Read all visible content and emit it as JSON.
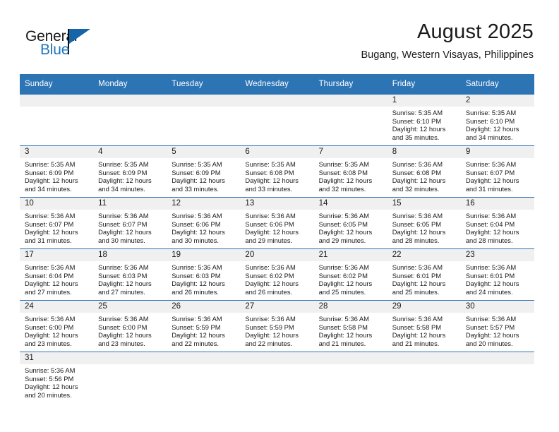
{
  "brand": {
    "name_part1": "General",
    "name_part2": "Blue",
    "flag_color": "#1565a8",
    "blue_color": "#2175bb"
  },
  "header": {
    "title": "August 2025",
    "subtitle": "Bugang, Western Visayas, Philippines"
  },
  "theme": {
    "header_blue": "#2d74b5",
    "daynum_band": "#f0f0f0",
    "text": "#1a1a1a"
  },
  "calendar": {
    "weekday_headers": [
      "Sunday",
      "Monday",
      "Tuesday",
      "Wednesday",
      "Thursday",
      "Friday",
      "Saturday"
    ],
    "weeks": [
      [
        {
          "day": "",
          "empty": true,
          "sunrise": "",
          "sunset": "",
          "daylight1": "",
          "daylight2": ""
        },
        {
          "day": "",
          "empty": true,
          "sunrise": "",
          "sunset": "",
          "daylight1": "",
          "daylight2": ""
        },
        {
          "day": "",
          "empty": true,
          "sunrise": "",
          "sunset": "",
          "daylight1": "",
          "daylight2": ""
        },
        {
          "day": "",
          "empty": true,
          "sunrise": "",
          "sunset": "",
          "daylight1": "",
          "daylight2": ""
        },
        {
          "day": "",
          "empty": true,
          "sunrise": "",
          "sunset": "",
          "daylight1": "",
          "daylight2": ""
        },
        {
          "day": "1",
          "sunrise": "Sunrise: 5:35 AM",
          "sunset": "Sunset: 6:10 PM",
          "daylight1": "Daylight: 12 hours",
          "daylight2": "and 35 minutes."
        },
        {
          "day": "2",
          "sunrise": "Sunrise: 5:35 AM",
          "sunset": "Sunset: 6:10 PM",
          "daylight1": "Daylight: 12 hours",
          "daylight2": "and 34 minutes."
        }
      ],
      [
        {
          "day": "3",
          "sunrise": "Sunrise: 5:35 AM",
          "sunset": "Sunset: 6:09 PM",
          "daylight1": "Daylight: 12 hours",
          "daylight2": "and 34 minutes."
        },
        {
          "day": "4",
          "sunrise": "Sunrise: 5:35 AM",
          "sunset": "Sunset: 6:09 PM",
          "daylight1": "Daylight: 12 hours",
          "daylight2": "and 34 minutes."
        },
        {
          "day": "5",
          "sunrise": "Sunrise: 5:35 AM",
          "sunset": "Sunset: 6:09 PM",
          "daylight1": "Daylight: 12 hours",
          "daylight2": "and 33 minutes."
        },
        {
          "day": "6",
          "sunrise": "Sunrise: 5:35 AM",
          "sunset": "Sunset: 6:08 PM",
          "daylight1": "Daylight: 12 hours",
          "daylight2": "and 33 minutes."
        },
        {
          "day": "7",
          "sunrise": "Sunrise: 5:35 AM",
          "sunset": "Sunset: 6:08 PM",
          "daylight1": "Daylight: 12 hours",
          "daylight2": "and 32 minutes."
        },
        {
          "day": "8",
          "sunrise": "Sunrise: 5:36 AM",
          "sunset": "Sunset: 6:08 PM",
          "daylight1": "Daylight: 12 hours",
          "daylight2": "and 32 minutes."
        },
        {
          "day": "9",
          "sunrise": "Sunrise: 5:36 AM",
          "sunset": "Sunset: 6:07 PM",
          "daylight1": "Daylight: 12 hours",
          "daylight2": "and 31 minutes."
        }
      ],
      [
        {
          "day": "10",
          "sunrise": "Sunrise: 5:36 AM",
          "sunset": "Sunset: 6:07 PM",
          "daylight1": "Daylight: 12 hours",
          "daylight2": "and 31 minutes."
        },
        {
          "day": "11",
          "sunrise": "Sunrise: 5:36 AM",
          "sunset": "Sunset: 6:07 PM",
          "daylight1": "Daylight: 12 hours",
          "daylight2": "and 30 minutes."
        },
        {
          "day": "12",
          "sunrise": "Sunrise: 5:36 AM",
          "sunset": "Sunset: 6:06 PM",
          "daylight1": "Daylight: 12 hours",
          "daylight2": "and 30 minutes."
        },
        {
          "day": "13",
          "sunrise": "Sunrise: 5:36 AM",
          "sunset": "Sunset: 6:06 PM",
          "daylight1": "Daylight: 12 hours",
          "daylight2": "and 29 minutes."
        },
        {
          "day": "14",
          "sunrise": "Sunrise: 5:36 AM",
          "sunset": "Sunset: 6:05 PM",
          "daylight1": "Daylight: 12 hours",
          "daylight2": "and 29 minutes."
        },
        {
          "day": "15",
          "sunrise": "Sunrise: 5:36 AM",
          "sunset": "Sunset: 6:05 PM",
          "daylight1": "Daylight: 12 hours",
          "daylight2": "and 28 minutes."
        },
        {
          "day": "16",
          "sunrise": "Sunrise: 5:36 AM",
          "sunset": "Sunset: 6:04 PM",
          "daylight1": "Daylight: 12 hours",
          "daylight2": "and 28 minutes."
        }
      ],
      [
        {
          "day": "17",
          "sunrise": "Sunrise: 5:36 AM",
          "sunset": "Sunset: 6:04 PM",
          "daylight1": "Daylight: 12 hours",
          "daylight2": "and 27 minutes."
        },
        {
          "day": "18",
          "sunrise": "Sunrise: 5:36 AM",
          "sunset": "Sunset: 6:03 PM",
          "daylight1": "Daylight: 12 hours",
          "daylight2": "and 27 minutes."
        },
        {
          "day": "19",
          "sunrise": "Sunrise: 5:36 AM",
          "sunset": "Sunset: 6:03 PM",
          "daylight1": "Daylight: 12 hours",
          "daylight2": "and 26 minutes."
        },
        {
          "day": "20",
          "sunrise": "Sunrise: 5:36 AM",
          "sunset": "Sunset: 6:02 PM",
          "daylight1": "Daylight: 12 hours",
          "daylight2": "and 26 minutes."
        },
        {
          "day": "21",
          "sunrise": "Sunrise: 5:36 AM",
          "sunset": "Sunset: 6:02 PM",
          "daylight1": "Daylight: 12 hours",
          "daylight2": "and 25 minutes."
        },
        {
          "day": "22",
          "sunrise": "Sunrise: 5:36 AM",
          "sunset": "Sunset: 6:01 PM",
          "daylight1": "Daylight: 12 hours",
          "daylight2": "and 25 minutes."
        },
        {
          "day": "23",
          "sunrise": "Sunrise: 5:36 AM",
          "sunset": "Sunset: 6:01 PM",
          "daylight1": "Daylight: 12 hours",
          "daylight2": "and 24 minutes."
        }
      ],
      [
        {
          "day": "24",
          "sunrise": "Sunrise: 5:36 AM",
          "sunset": "Sunset: 6:00 PM",
          "daylight1": "Daylight: 12 hours",
          "daylight2": "and 23 minutes."
        },
        {
          "day": "25",
          "sunrise": "Sunrise: 5:36 AM",
          "sunset": "Sunset: 6:00 PM",
          "daylight1": "Daylight: 12 hours",
          "daylight2": "and 23 minutes."
        },
        {
          "day": "26",
          "sunrise": "Sunrise: 5:36 AM",
          "sunset": "Sunset: 5:59 PM",
          "daylight1": "Daylight: 12 hours",
          "daylight2": "and 22 minutes."
        },
        {
          "day": "27",
          "sunrise": "Sunrise: 5:36 AM",
          "sunset": "Sunset: 5:59 PM",
          "daylight1": "Daylight: 12 hours",
          "daylight2": "and 22 minutes."
        },
        {
          "day": "28",
          "sunrise": "Sunrise: 5:36 AM",
          "sunset": "Sunset: 5:58 PM",
          "daylight1": "Daylight: 12 hours",
          "daylight2": "and 21 minutes."
        },
        {
          "day": "29",
          "sunrise": "Sunrise: 5:36 AM",
          "sunset": "Sunset: 5:58 PM",
          "daylight1": "Daylight: 12 hours",
          "daylight2": "and 21 minutes."
        },
        {
          "day": "30",
          "sunrise": "Sunrise: 5:36 AM",
          "sunset": "Sunset: 5:57 PM",
          "daylight1": "Daylight: 12 hours",
          "daylight2": "and 20 minutes."
        }
      ],
      [
        {
          "day": "31",
          "sunrise": "Sunrise: 5:36 AM",
          "sunset": "Sunset: 5:56 PM",
          "daylight1": "Daylight: 12 hours",
          "daylight2": "and 20 minutes."
        },
        {
          "day": "",
          "empty": true,
          "sunrise": "",
          "sunset": "",
          "daylight1": "",
          "daylight2": ""
        },
        {
          "day": "",
          "empty": true,
          "sunrise": "",
          "sunset": "",
          "daylight1": "",
          "daylight2": ""
        },
        {
          "day": "",
          "empty": true,
          "sunrise": "",
          "sunset": "",
          "daylight1": "",
          "daylight2": ""
        },
        {
          "day": "",
          "empty": true,
          "sunrise": "",
          "sunset": "",
          "daylight1": "",
          "daylight2": ""
        },
        {
          "day": "",
          "empty": true,
          "sunrise": "",
          "sunset": "",
          "daylight1": "",
          "daylight2": ""
        },
        {
          "day": "",
          "empty": true,
          "sunrise": "",
          "sunset": "",
          "daylight1": "",
          "daylight2": ""
        }
      ]
    ]
  }
}
